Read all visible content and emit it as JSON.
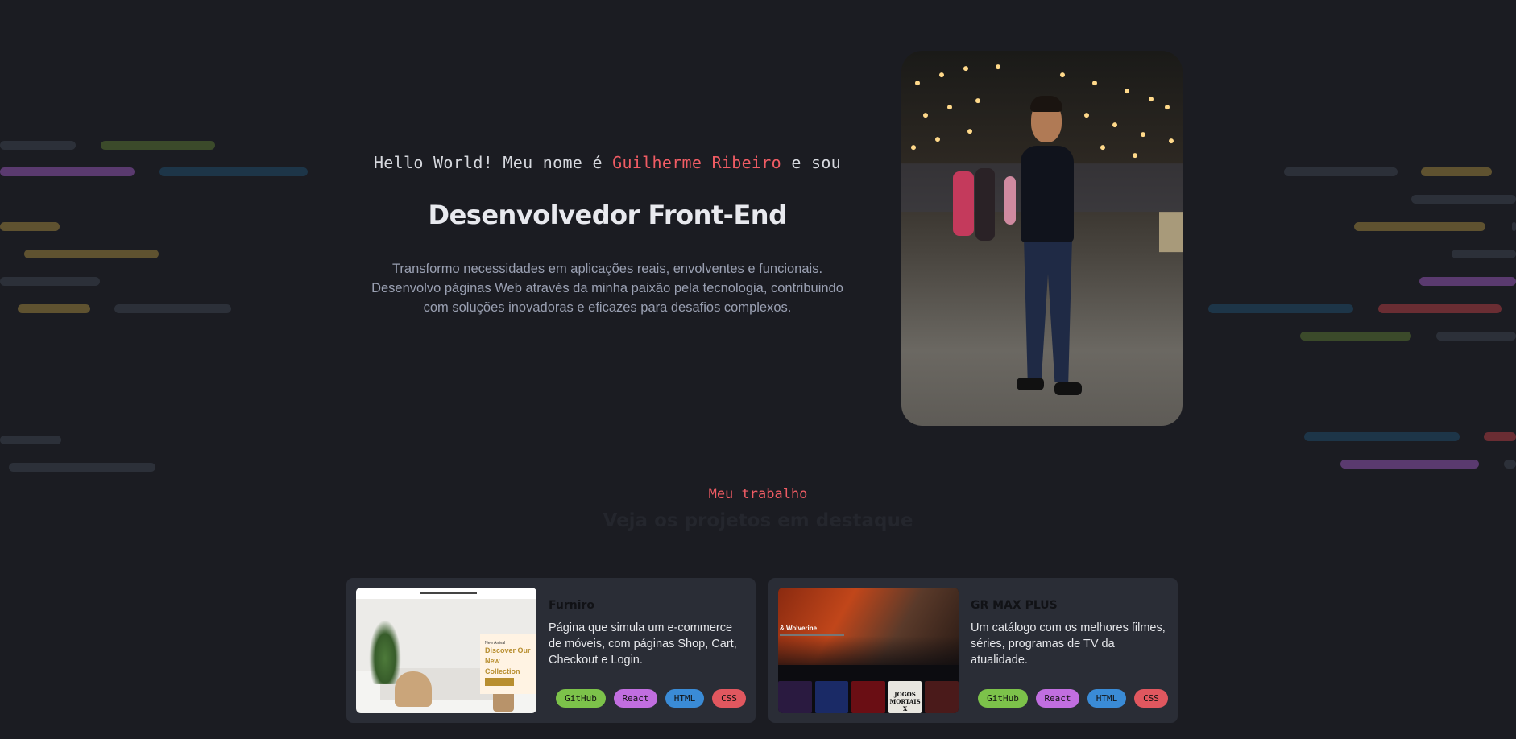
{
  "hero": {
    "greeting_prefix": "Hello World! Meu nome é",
    "name": "Guilherme Ribeiro",
    "greeting_suffix": "e sou",
    "role": "Desenvolvedor Front-End",
    "description": "Transformo necessidades em aplicações reais, envolventes e funcionais. Desenvolvo páginas Web através da minha paixão pela tecnologia, contribuindo com soluções inovadoras e eficazes para desafios complexos."
  },
  "work": {
    "tag": "Meu trabalho",
    "title": "Veja os projetos em destaque"
  },
  "projects": [
    {
      "title": "Furniro",
      "description": "Página que simula um e-commerce de móveis, com páginas Shop, Cart, Checkout e Login.",
      "thumbnail": {
        "kicker": "New Arrival",
        "headline": "Discover Our New Collection"
      },
      "tags": [
        "GitHub",
        "React",
        "HTML",
        "CSS"
      ]
    },
    {
      "title": "GR MAX PLUS",
      "description": "Um catálogo com os melhores filmes, séries, programas de TV da atualidade.",
      "thumbnail": {
        "title": "& Wolverine",
        "poster_label": "JOGOS MORTAIS X"
      },
      "tags": [
        "GitHub",
        "React",
        "HTML",
        "CSS"
      ]
    }
  ],
  "colors": {
    "background": "#1b1c22",
    "accent": "#f05c64",
    "card": "#2a2d36",
    "tag_github": "#7cc24a",
    "tag_react": "#c16ee0",
    "tag_html": "#3a8bd6",
    "tag_css": "#e0575f"
  }
}
